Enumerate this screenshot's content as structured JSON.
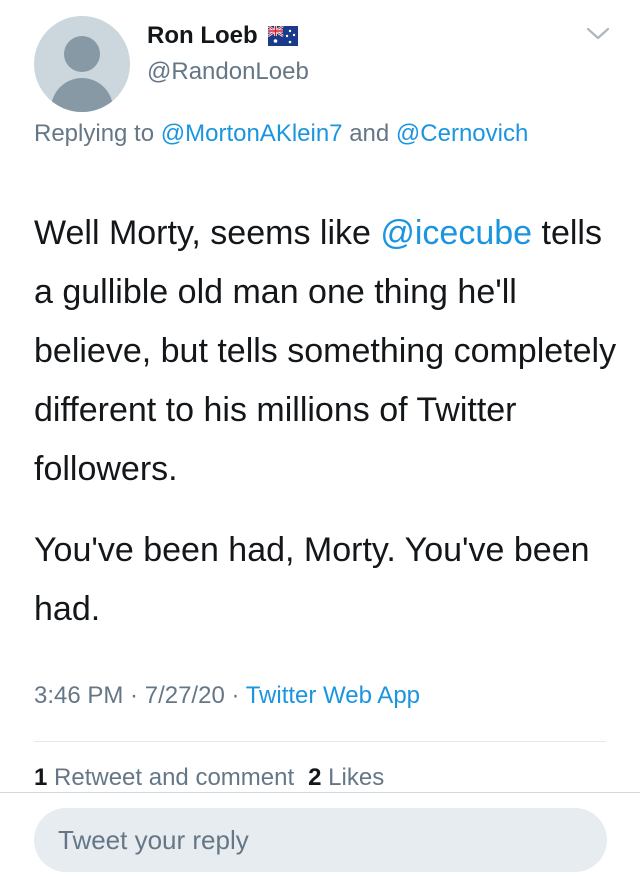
{
  "author": {
    "display_name": "Ron Loeb",
    "handle": "@RandonLoeb",
    "flag_icon": "australia-flag-icon"
  },
  "replying": {
    "prefix": "Replying to ",
    "mention_1": "@MortonAKlein7",
    "joiner": " and",
    "mention_2": "@Cernovich"
  },
  "tweet": {
    "p1_before": "Well Morty, seems like ",
    "p1_mention": "@icecube",
    "p1_after": " tells a gullible old man one thing he'll believe, but tells something completely different to his millions of Twitter followers.",
    "p2": "You've been had, Morty. You've been had."
  },
  "meta": {
    "time": "3:46 PM",
    "sep1": " · ",
    "date": "7/27/20",
    "sep2": " · ",
    "source": "Twitter Web App"
  },
  "stats": {
    "retweets_count": "1",
    "retweets_label": " Retweet and comment",
    "likes_count": "2",
    "likes_label": " Likes"
  },
  "reply_box": {
    "placeholder": "Tweet your reply"
  },
  "colors": {
    "link": "#1b95e0",
    "secondary": "#657786",
    "text": "#14171a"
  }
}
